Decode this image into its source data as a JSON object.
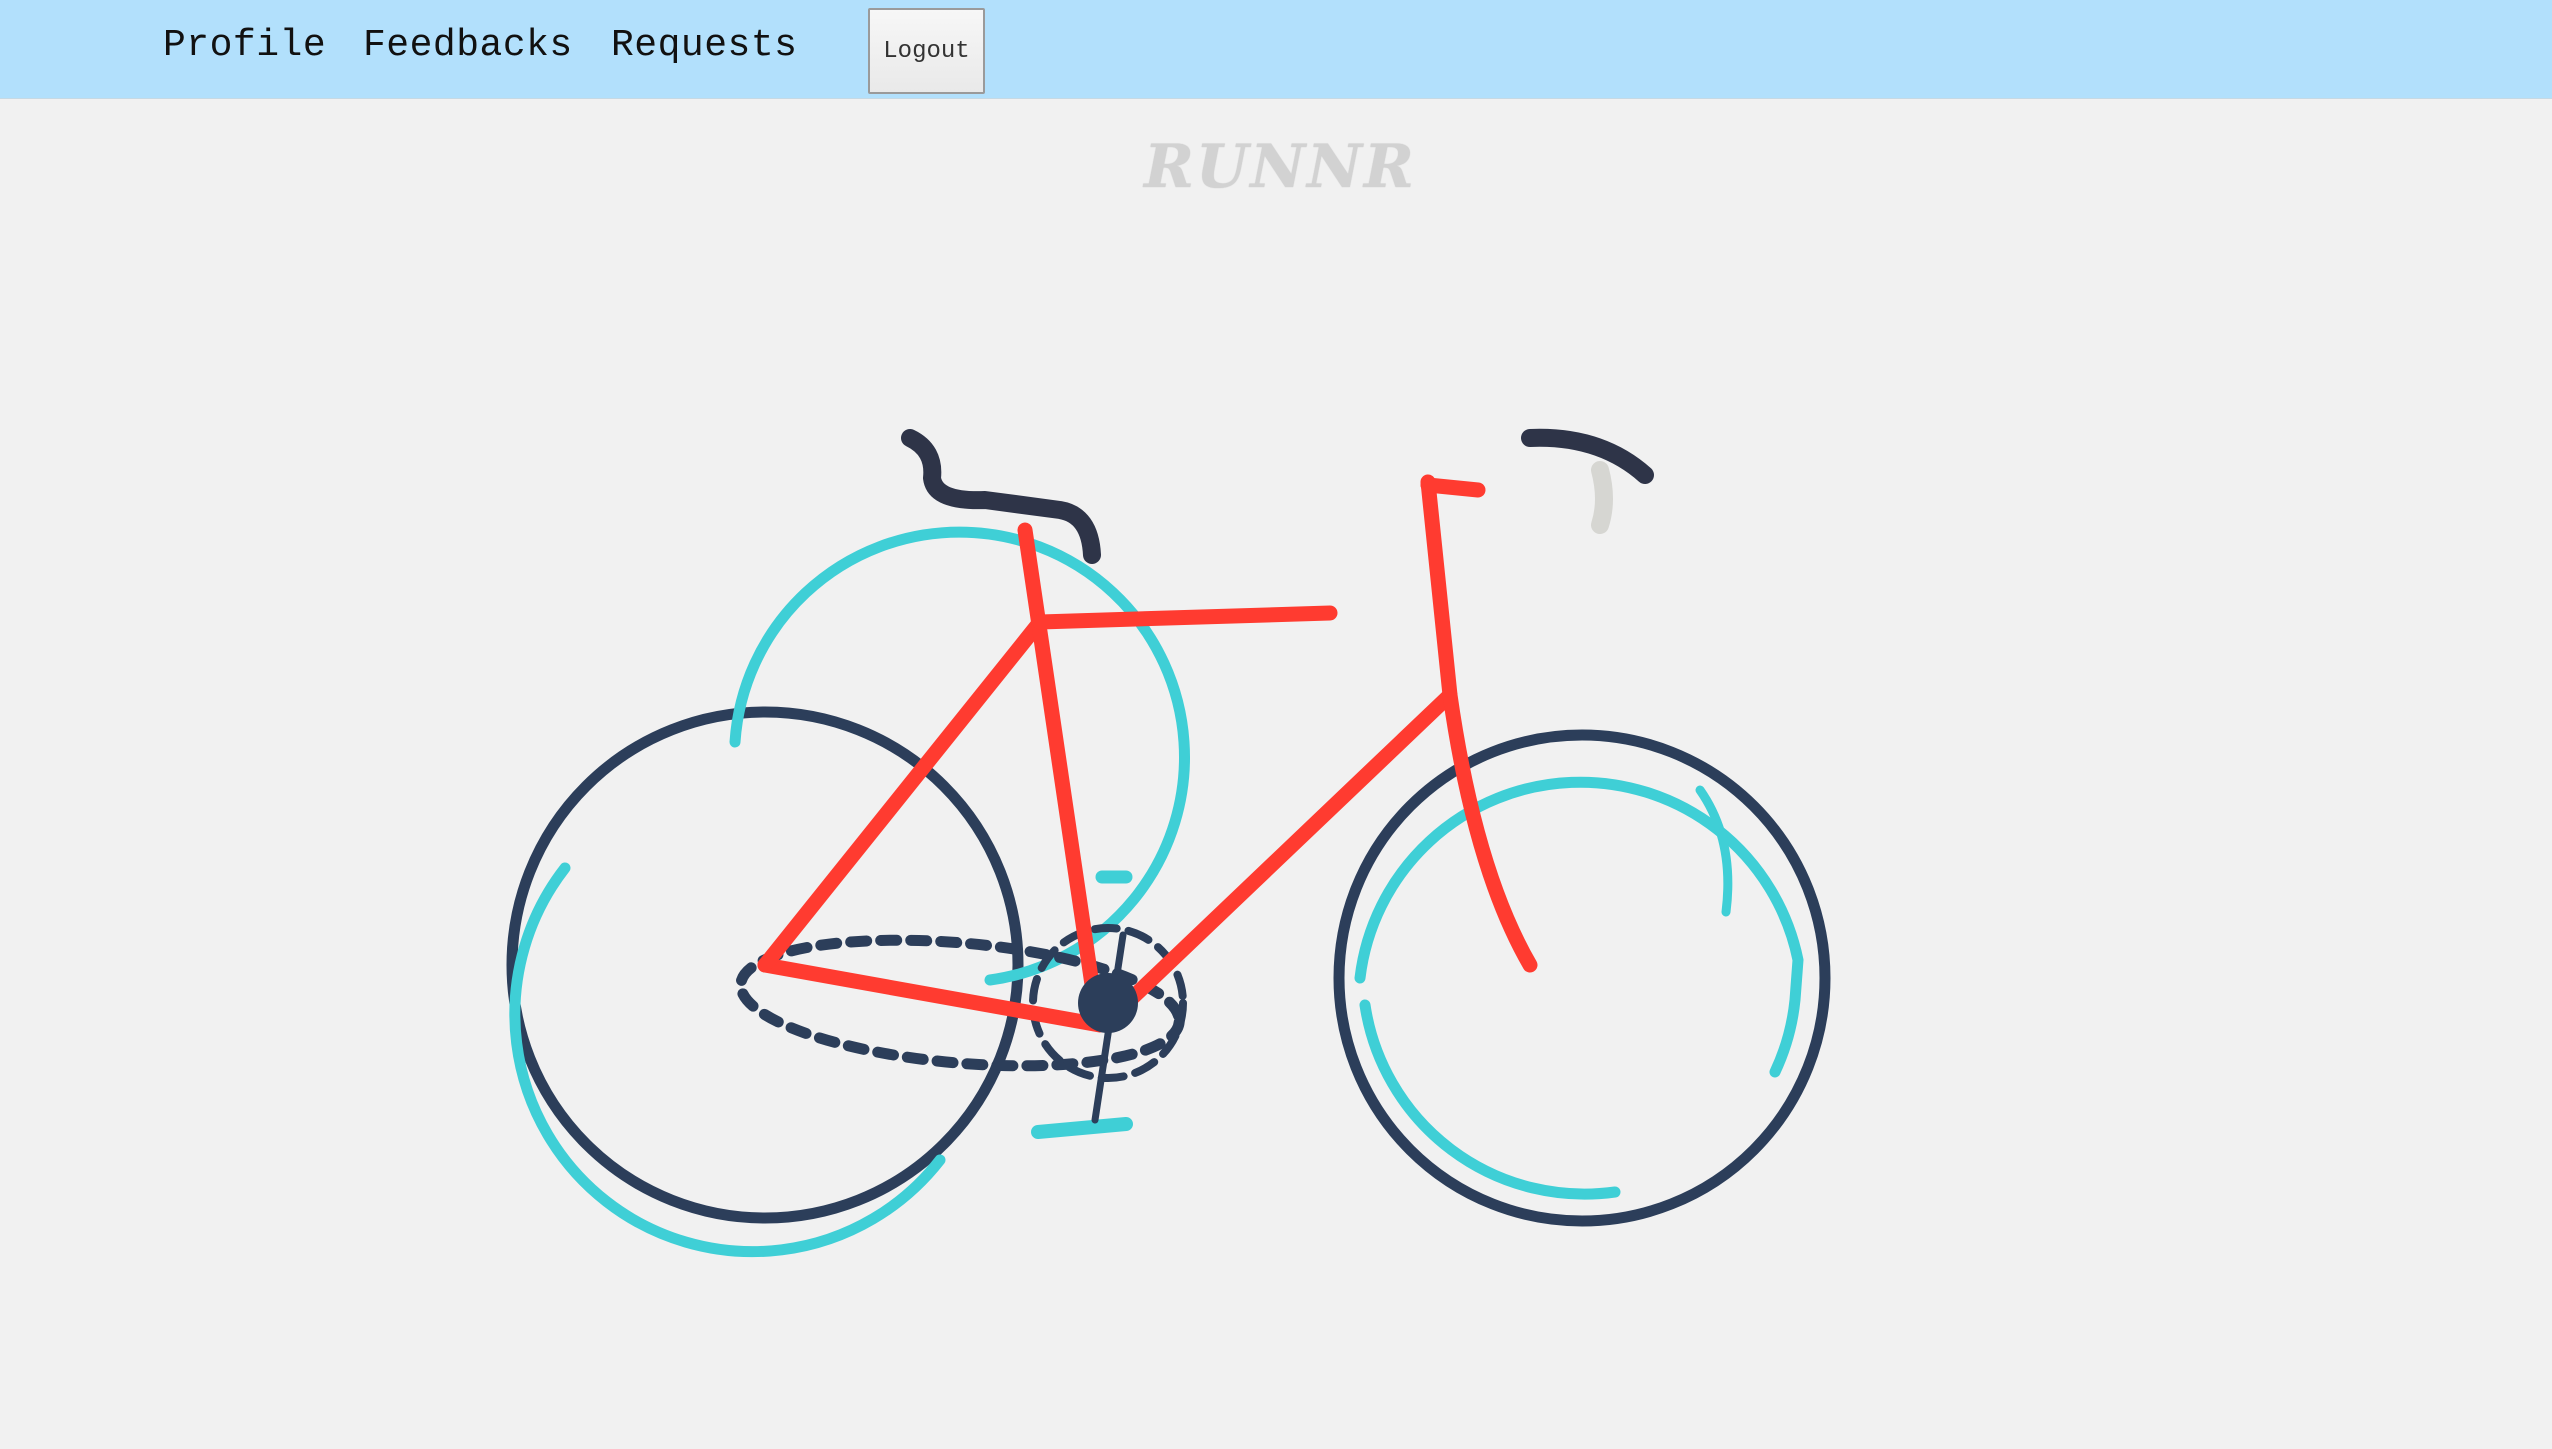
{
  "nav": {
    "profile": "Profile",
    "feedbacks": "Feedbacks",
    "requests": "Requests",
    "logout": "Logout"
  },
  "brand": {
    "name": "RUNNR"
  },
  "illustration": {
    "name": "bicycle-illustration",
    "colors": {
      "frame": "#ff3b30",
      "tire": "#2c3e5a",
      "rim": "#3fcfd6",
      "handlebar": "#2e3448",
      "saddle": "#2e3448",
      "background": "#f1f1f1"
    }
  }
}
